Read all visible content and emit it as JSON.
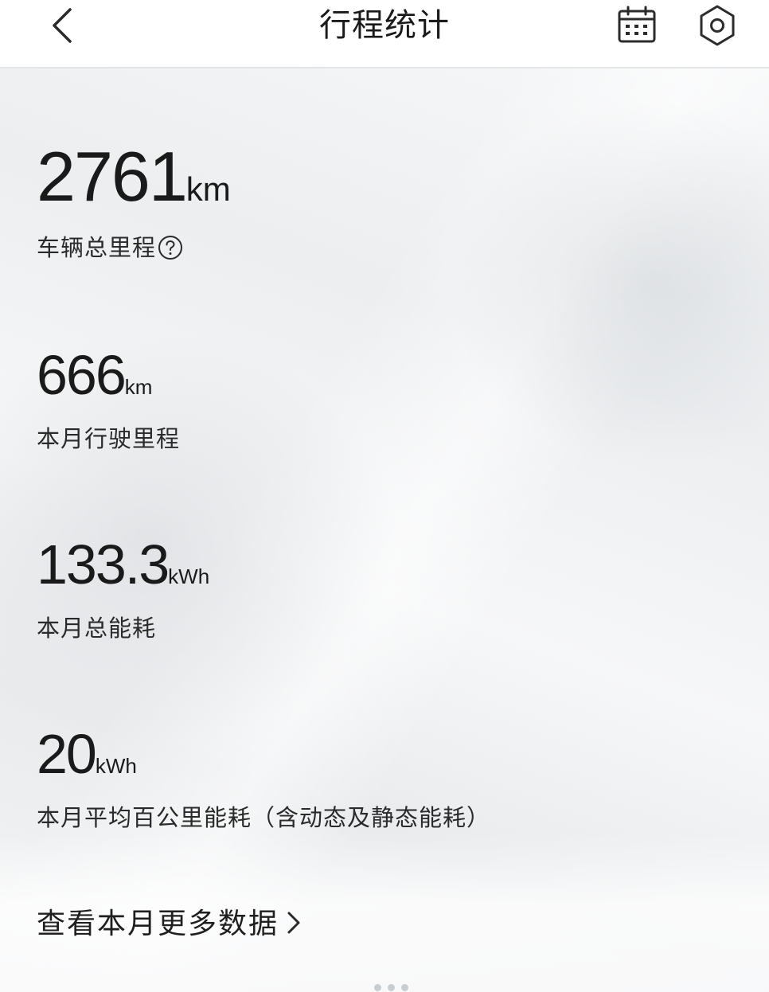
{
  "header": {
    "title": "行程统计",
    "back_icon": "chevron-left-icon",
    "calendar_icon": "calendar-icon",
    "settings_icon": "settings-hexagon-icon"
  },
  "stats": {
    "total_mileage": {
      "value": "2761",
      "unit": "km",
      "label": "车辆总里程",
      "help_icon": "help-circle-icon"
    },
    "month_mileage": {
      "value": "666",
      "unit": "km",
      "label": "本月行驶里程"
    },
    "month_energy": {
      "value": "133.3",
      "unit": "kWh",
      "label": "本月总能耗"
    },
    "avg_energy": {
      "value": "20",
      "unit": "kWh",
      "label": "本月平均百公里能耗（含动态及静态能耗）"
    }
  },
  "more_link": {
    "label": "查看本月更多数据",
    "icon": "chevron-right-icon"
  },
  "colors": {
    "text": "#1a1a1a",
    "header_bg": "#ffffff",
    "content_bg": "#f1f2f3"
  }
}
